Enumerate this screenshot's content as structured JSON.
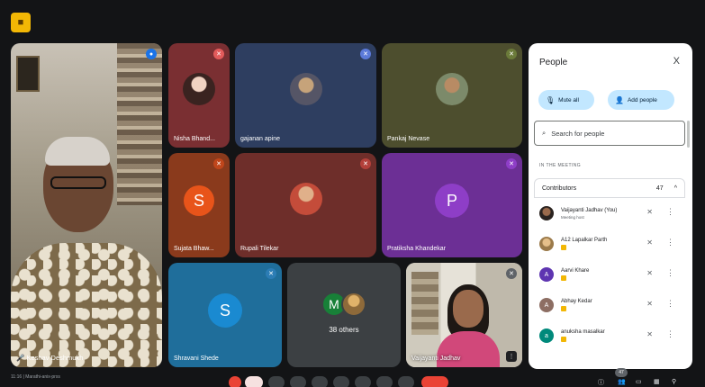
{
  "app": {
    "badge_icon": "meet-app-icon",
    "badge_glyph": "■"
  },
  "speaker": {
    "name": "Keshav Deshmukh",
    "name_prefix": "🎤",
    "mic_glyph": "●"
  },
  "tiles": [
    {
      "id": "nisha",
      "name": "Nisha Bhand...",
      "type": "photo",
      "mic_color": "#e25b5b"
    },
    {
      "id": "gajanan",
      "name": "gajanan apine",
      "type": "photo",
      "mic_color": "#5b7ad9"
    },
    {
      "id": "pankaj",
      "name": "Pankaj Nevase",
      "type": "photo",
      "mic_color": "#6b7a3a"
    },
    {
      "id": "sujata",
      "name": "Sujata Bhaw...",
      "type": "letter",
      "letter": "S",
      "avatar_color": "#e8541a",
      "mic_color": "#c0461b"
    },
    {
      "id": "rupali",
      "name": "Rupali Tilekar",
      "type": "photo",
      "mic_color": "#b3403a"
    },
    {
      "id": "pratiksha",
      "name": "Pratiksha Khandekar",
      "type": "letter",
      "letter": "P",
      "avatar_color": "#8e3ec7",
      "mic_color": "#8e3ec7"
    },
    {
      "id": "shravani",
      "name": "Shravani Shede",
      "type": "letter",
      "letter": "S",
      "avatar_color": "#1a8ad1",
      "mic_color": "#2c7db5"
    },
    {
      "id": "vaijayanti",
      "name": "Vaijayanti Jadhav",
      "type": "video"
    }
  ],
  "others": {
    "label": "38 others",
    "letter": "M"
  },
  "panel": {
    "title": "People",
    "close_glyph": "X",
    "mute_all": "Mute all",
    "add_people": "Add people",
    "search_placeholder": "Search for people",
    "section_label": "IN THE MEETING",
    "contributors_label": "Contributors",
    "contributors_count": "47",
    "participants": [
      {
        "name": "Vaijayanti Jadhav (You)",
        "sub": "Meeting host",
        "avatar": "photo",
        "color": "#6b5a4a"
      },
      {
        "name": "A12 Lapalkar Parth",
        "sub": "",
        "avatar": "photo",
        "color": "#c9a36a",
        "tag": true
      },
      {
        "name": "Aarvi Khare",
        "sub": "",
        "avatar": "letter",
        "letter": "A",
        "color": "#5e35b1",
        "tag": true
      },
      {
        "name": "Abhay Kedar",
        "sub": "",
        "avatar": "letter",
        "letter": "A",
        "color": "#8d6e63",
        "tag": true
      },
      {
        "name": "anuksha masalkar",
        "sub": "",
        "avatar": "letter",
        "letter": "a",
        "color": "#00897b",
        "tag": true
      }
    ]
  },
  "bottom": {
    "meeting_info": "11:16 | Marathi-anix-prxs",
    "participant_count": "47"
  }
}
